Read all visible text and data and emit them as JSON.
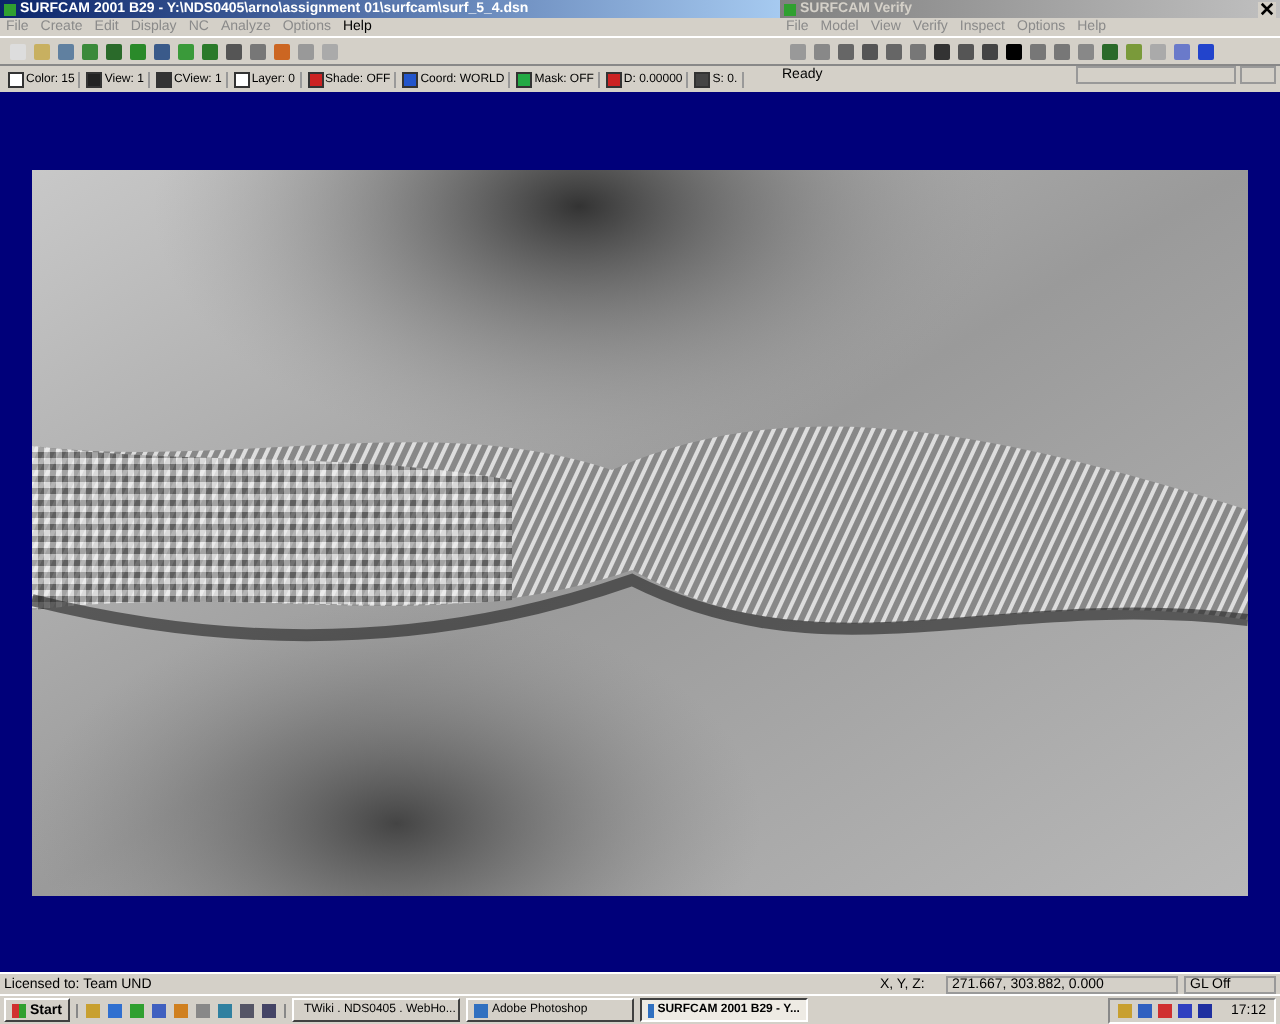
{
  "main_window": {
    "title": "SURFCAM 2001 B29 - Y:\\NDS0405\\arno\\assignment 01\\surfcam\\surf_5_4.dsn",
    "menu": [
      {
        "label": "File",
        "disabled": true
      },
      {
        "label": "Create",
        "disabled": true
      },
      {
        "label": "Edit",
        "disabled": true
      },
      {
        "label": "Display",
        "disabled": true
      },
      {
        "label": "NC",
        "disabled": true
      },
      {
        "label": "Analyze",
        "disabled": true
      },
      {
        "label": "Options",
        "disabled": true
      },
      {
        "label": "Help",
        "disabled": false
      }
    ],
    "status_toolbar": [
      {
        "label": "Color: 15"
      },
      {
        "label": "View: 1"
      },
      {
        "label": "CView: 1"
      },
      {
        "label": "Layer: 0"
      },
      {
        "label": "Shade: OFF"
      },
      {
        "label": "Coord: WORLD"
      },
      {
        "label": "Mask: OFF"
      },
      {
        "label": "D: 0.00000"
      },
      {
        "label": "S: 0."
      }
    ]
  },
  "verify_window": {
    "title": "SURFCAM Verify",
    "menu": [
      {
        "label": "File",
        "disabled": true
      },
      {
        "label": "Model",
        "disabled": true
      },
      {
        "label": "View",
        "disabled": true
      },
      {
        "label": "Verify",
        "disabled": true
      },
      {
        "label": "Inspect",
        "disabled": true
      },
      {
        "label": "Options",
        "disabled": true
      },
      {
        "label": "Help",
        "disabled": true
      }
    ],
    "status": "Ready"
  },
  "status_bar": {
    "license": "Licensed to: Team UND",
    "coords_label": "X, Y, Z:",
    "coords": "271.667, 303.882, 0.000",
    "gl": "GL Off"
  },
  "taskbar": {
    "start": "Start",
    "tasks": [
      {
        "label": "TWiki . NDS0405 . WebHo...",
        "selected": false
      },
      {
        "label": "Adobe Photoshop",
        "selected": false
      },
      {
        "label": "SURFCAM 2001 B29 - Y...",
        "selected": true
      }
    ],
    "clock": "17:12"
  }
}
